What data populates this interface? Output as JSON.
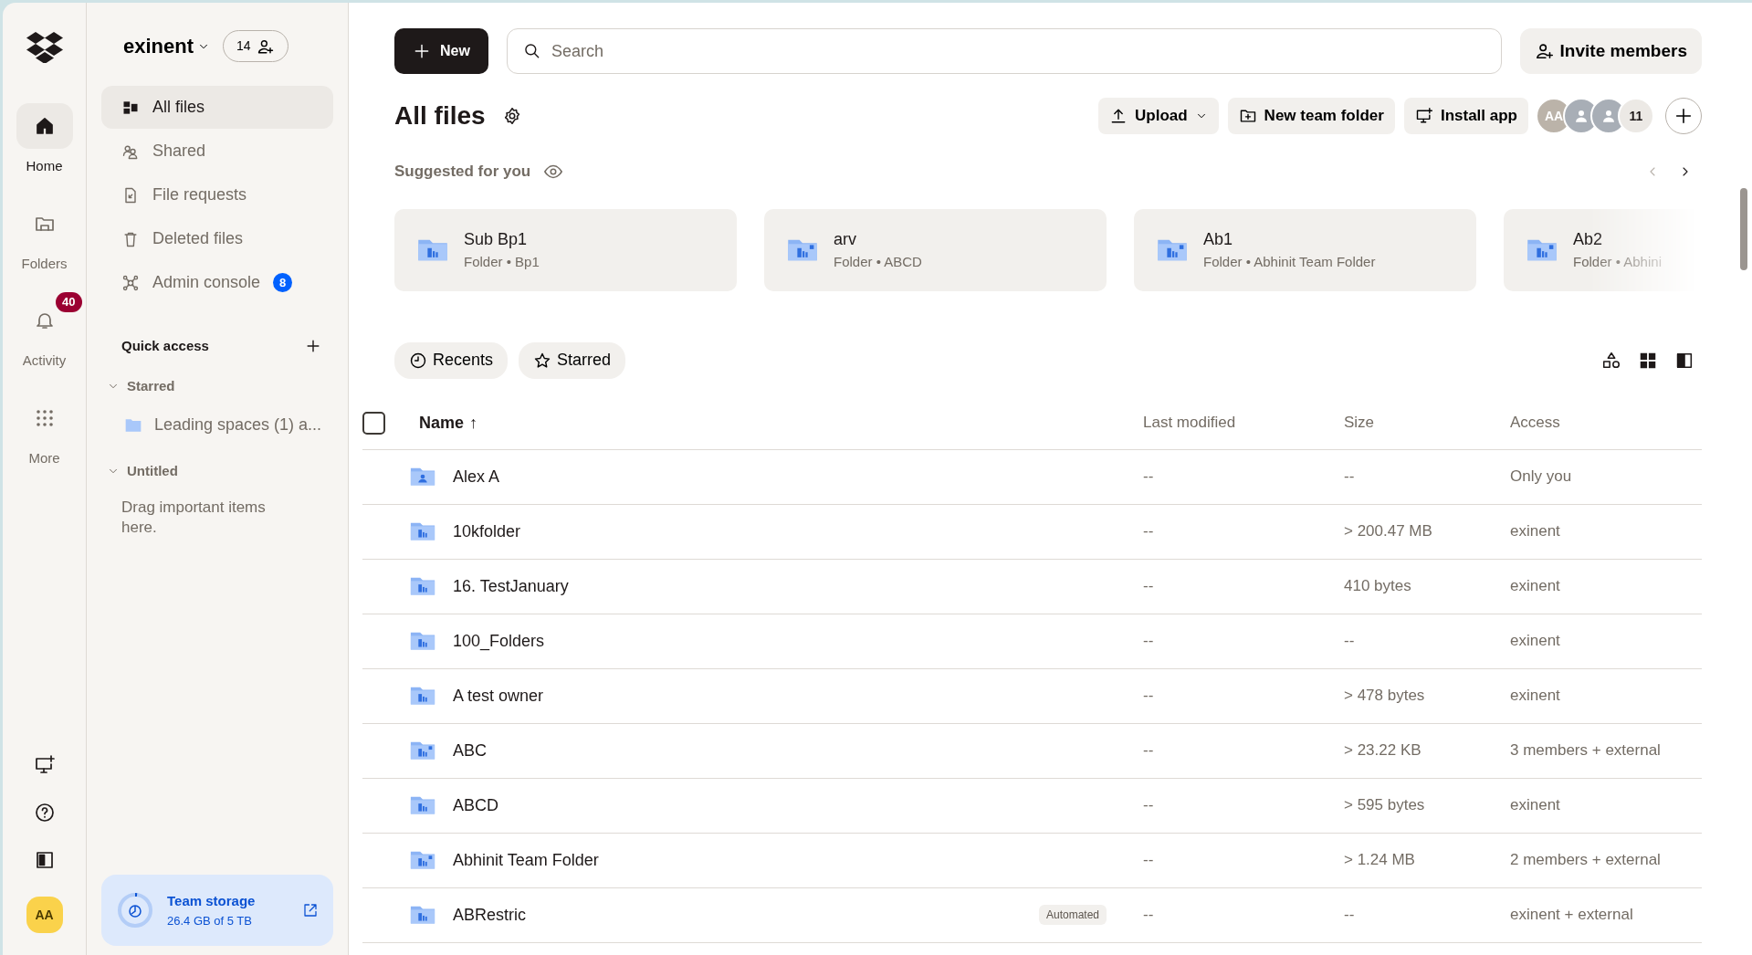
{
  "rail": {
    "items": [
      {
        "label": "Home",
        "kind": "home",
        "selected": true
      },
      {
        "label": "Folders",
        "kind": "folders",
        "selected": false
      },
      {
        "label": "Activity",
        "kind": "bell",
        "selected": false,
        "badge": "40"
      },
      {
        "label": "More",
        "kind": "grid",
        "selected": false
      }
    ],
    "avatar": "AA"
  },
  "workspace": {
    "name": "exinent",
    "members": "14"
  },
  "nav": [
    {
      "label": "All files",
      "kind": "files",
      "selected": true
    },
    {
      "label": "Shared",
      "kind": "shared",
      "selected": false
    },
    {
      "label": "File requests",
      "kind": "request",
      "selected": false
    },
    {
      "label": "Deleted files",
      "kind": "trash",
      "selected": false
    },
    {
      "label": "Admin console",
      "kind": "admin",
      "selected": false,
      "badge": "8"
    }
  ],
  "quick_access": {
    "title": "Quick access",
    "groups": [
      {
        "label": "Starred",
        "expanded": true,
        "items": [
          "Leading spaces (1) a..."
        ]
      },
      {
        "label": "Untitled",
        "expanded": true,
        "empty_text": "Drag important items here."
      }
    ]
  },
  "storage": {
    "title": "Team storage",
    "usage": "26.4 GB of 5 TB",
    "level": 0.02
  },
  "toolbar": {
    "new_button": "New",
    "search": {
      "placeholder": "Search"
    },
    "invite_button": "Invite members"
  },
  "page_title": "All files",
  "actions": [
    {
      "label": "Upload",
      "kind": "upload",
      "dropdown": true
    },
    {
      "label": "New team folder",
      "kind": "folder-plus",
      "dropdown": false
    },
    {
      "label": "Install app",
      "kind": "monitor",
      "dropdown": false
    }
  ],
  "members": {
    "avatars": [
      {
        "kind": "initials",
        "initials": "AA"
      },
      {
        "kind": "person"
      },
      {
        "kind": "person"
      }
    ],
    "overflow": "11"
  },
  "suggested": {
    "title": "Suggested for you",
    "cards": [
      {
        "name": "Sub Bp1",
        "meta": "Folder • Bp1",
        "kind": "team"
      },
      {
        "name": "arv",
        "meta": "Folder • ABCD",
        "kind": "shared"
      },
      {
        "name": "Ab1",
        "meta": "Folder • Abhinit Team Folder",
        "kind": "shared"
      },
      {
        "name": "Ab2",
        "meta": "Folder • Abhini",
        "kind": "shared"
      }
    ]
  },
  "filters": [
    {
      "label": "Recents",
      "kind": "clock"
    },
    {
      "label": "Starred",
      "kind": "star"
    }
  ],
  "table": {
    "select_all": {
      "checked": false
    },
    "columns": [
      {
        "label": "Name",
        "sort_mark": "↑"
      },
      {
        "label": "Last modified"
      },
      {
        "label": "Size"
      },
      {
        "label": "Access"
      }
    ],
    "rows": [
      {
        "name": "Alex A",
        "kind": "personal",
        "modified": "--",
        "size": "--",
        "access": "Only you"
      },
      {
        "name": "10kfolder",
        "kind": "team",
        "modified": "--",
        "size": "> 200.47 MB",
        "access": "exinent"
      },
      {
        "name": "16. TestJanuary",
        "kind": "team",
        "modified": "--",
        "size": "410 bytes",
        "access": "exinent"
      },
      {
        "name": "100_Folders",
        "kind": "team",
        "modified": "--",
        "size": "--",
        "access": "exinent"
      },
      {
        "name": "A test owner",
        "kind": "team",
        "modified": "--",
        "size": "> 478 bytes",
        "access": "exinent"
      },
      {
        "name": "ABC",
        "kind": "shared",
        "modified": "--",
        "size": "> 23.22 KB",
        "access": "3 members + external"
      },
      {
        "name": "ABCD",
        "kind": "team",
        "modified": "--",
        "size": "> 595 bytes",
        "access": "exinent"
      },
      {
        "name": "Abhinit Team Folder",
        "kind": "shared",
        "modified": "--",
        "size": "> 1.24 MB",
        "access": "2 members + external"
      },
      {
        "name": "ABRestric",
        "kind": "team",
        "tag": "Automated",
        "modified": "--",
        "size": "--",
        "access": "exinent + external"
      }
    ]
  }
}
